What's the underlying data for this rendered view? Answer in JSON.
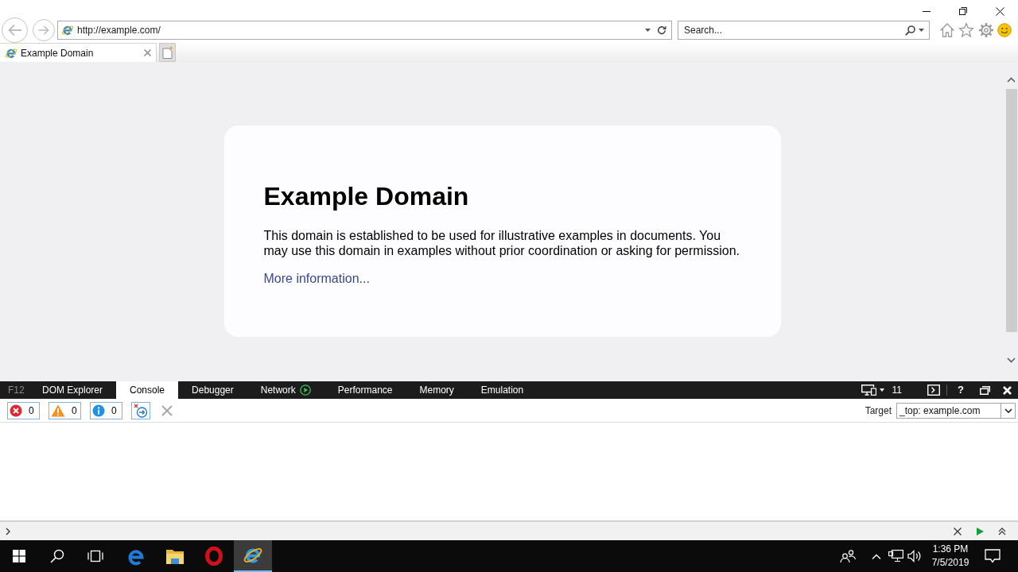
{
  "browser": {
    "address": "http://example.com/",
    "search_placeholder": "Search...",
    "tabs": [
      {
        "title": "Example Domain",
        "selected": true
      }
    ]
  },
  "page": {
    "heading": "Example Domain",
    "paragraph": "This domain is established to be used for illustrative examples in documents. You may use this domain in examples without prior coordination or asking for permission.",
    "link": "More information..."
  },
  "devtools": {
    "label": "F12",
    "tabs": [
      {
        "label": "DOM Explorer",
        "selected": false,
        "kind": "plain"
      },
      {
        "label": "Console",
        "selected": true,
        "kind": "plain"
      },
      {
        "label": "Debugger",
        "selected": false,
        "kind": "plain"
      },
      {
        "label": "Network",
        "selected": false,
        "kind": "capture"
      },
      {
        "label": "Performance",
        "selected": false,
        "kind": "plain"
      },
      {
        "label": "Memory",
        "selected": false,
        "kind": "plain"
      },
      {
        "label": "Emulation",
        "selected": false,
        "kind": "plain"
      }
    ],
    "document_mode": "11",
    "help": "?",
    "counters": [
      {
        "kind": "error",
        "count": "0"
      },
      {
        "kind": "warning",
        "count": "0"
      },
      {
        "kind": "info",
        "count": "0"
      }
    ],
    "target": {
      "label": "Target",
      "value": "_top: example.com"
    }
  },
  "taskbar": {
    "apps": [
      {
        "kind": "edge",
        "selected": false
      },
      {
        "kind": "explorer",
        "selected": false
      },
      {
        "kind": "opera",
        "selected": false
      },
      {
        "kind": "ie",
        "selected": true
      }
    ],
    "time": "1:36 PM",
    "date": "7/5/2019"
  }
}
